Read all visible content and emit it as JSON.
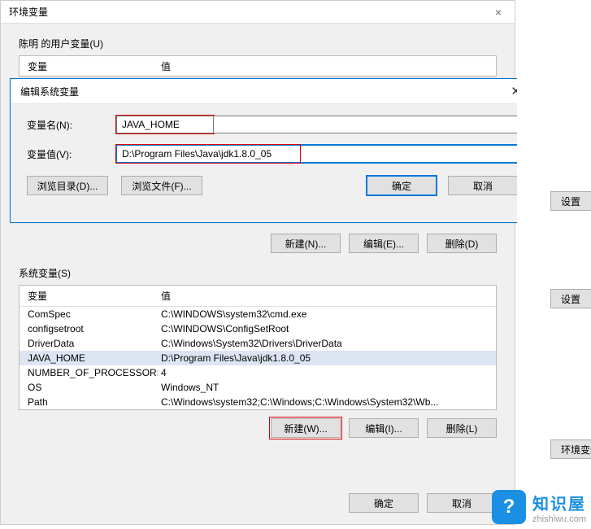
{
  "outer": {
    "title": "环境变量",
    "user_section_label": "陈明 的用户变量(U)",
    "system_section_label": "系统变量(S)",
    "headers": {
      "var": "变量",
      "val": "值"
    },
    "user_row_buttons": {
      "new": "新建(N)...",
      "edit": "编辑(E)...",
      "del": "删除(D)"
    },
    "system_rows": [
      {
        "var": "ComSpec",
        "val": "C:\\WINDOWS\\system32\\cmd.exe"
      },
      {
        "var": "configsetroot",
        "val": "C:\\WINDOWS\\ConfigSetRoot"
      },
      {
        "var": "DriverData",
        "val": "C:\\Windows\\System32\\Drivers\\DriverData"
      },
      {
        "var": "JAVA_HOME",
        "val": "D:\\Program Files\\Java\\jdk1.8.0_05",
        "selected": true
      },
      {
        "var": "NUMBER_OF_PROCESSORS",
        "val": "4"
      },
      {
        "var": "OS",
        "val": "Windows_NT"
      },
      {
        "var": "Path",
        "val": "C:\\Windows\\system32;C:\\Windows;C:\\Windows\\System32\\Wb..."
      }
    ],
    "system_row_buttons": {
      "new": "新建(W)...",
      "edit": "编辑(I)...",
      "del": "删除(L)"
    },
    "footer": {
      "ok": "确定",
      "cancel": "取消"
    }
  },
  "dialog": {
    "title": "编辑系统变量",
    "name_label": "变量名(N):",
    "value_label": "变量值(V):",
    "name_value": "JAVA_HOME",
    "value_value": "D:\\Program Files\\Java\\jdk1.8.0_05",
    "browse_dir": "浏览目录(D)...",
    "browse_file": "浏览文件(F)...",
    "ok": "确定",
    "cancel": "取消"
  },
  "right": {
    "btn1": "设置",
    "btn2": "设置",
    "btn3": "环境变量"
  },
  "logo": {
    "cn": "知识屋",
    "en": "zhishiwu.com",
    "glyph": "?"
  }
}
